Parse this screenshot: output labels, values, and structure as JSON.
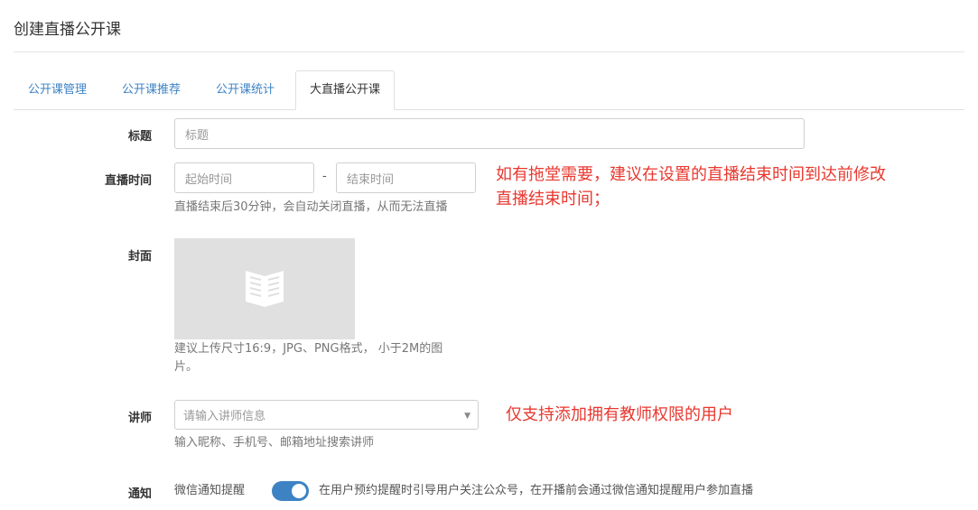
{
  "page": {
    "title": "创建直播公开课"
  },
  "tabs": [
    {
      "label": "公开课管理",
      "active": false
    },
    {
      "label": "公开课推荐",
      "active": false
    },
    {
      "label": "公开课统计",
      "active": false
    },
    {
      "label": "大直播公开课",
      "active": true
    }
  ],
  "form": {
    "title": {
      "label": "标题",
      "placeholder": "标题"
    },
    "live_time": {
      "label": "直播时间",
      "start_placeholder": "起始时间",
      "separator": "-",
      "end_placeholder": "结束时间",
      "help": "直播结束后30分钟，会自动关闭直播，从而无法直播"
    },
    "cover": {
      "label": "封面",
      "help_line1": "建议上传尺寸16:9，JPG、PNG格式， 小于2M的图",
      "help_line2": "片。",
      "placeholder_icon": "book-icon"
    },
    "teacher": {
      "label": "讲师",
      "placeholder": "请输入讲师信息",
      "help": "输入昵称、手机号、邮箱地址搜索讲师"
    },
    "notify": {
      "label": "通知",
      "option_label": "微信通知提醒",
      "enabled": true,
      "description": "在用户预约提醒时引导用户关注公众号，在开播前会通过微信通知提醒用户参加直播"
    }
  },
  "annotations": {
    "live_time_line1": "如有拖堂需要，建议在设置的直播结束时间到达前修改",
    "live_time_line2": "直播结束时间；",
    "teacher": "仅支持添加拥有教师权限的用户"
  },
  "colors": {
    "accent": "#3d83c4",
    "annotation": "#e8382f",
    "cover_bg": "#e0e0e0"
  }
}
